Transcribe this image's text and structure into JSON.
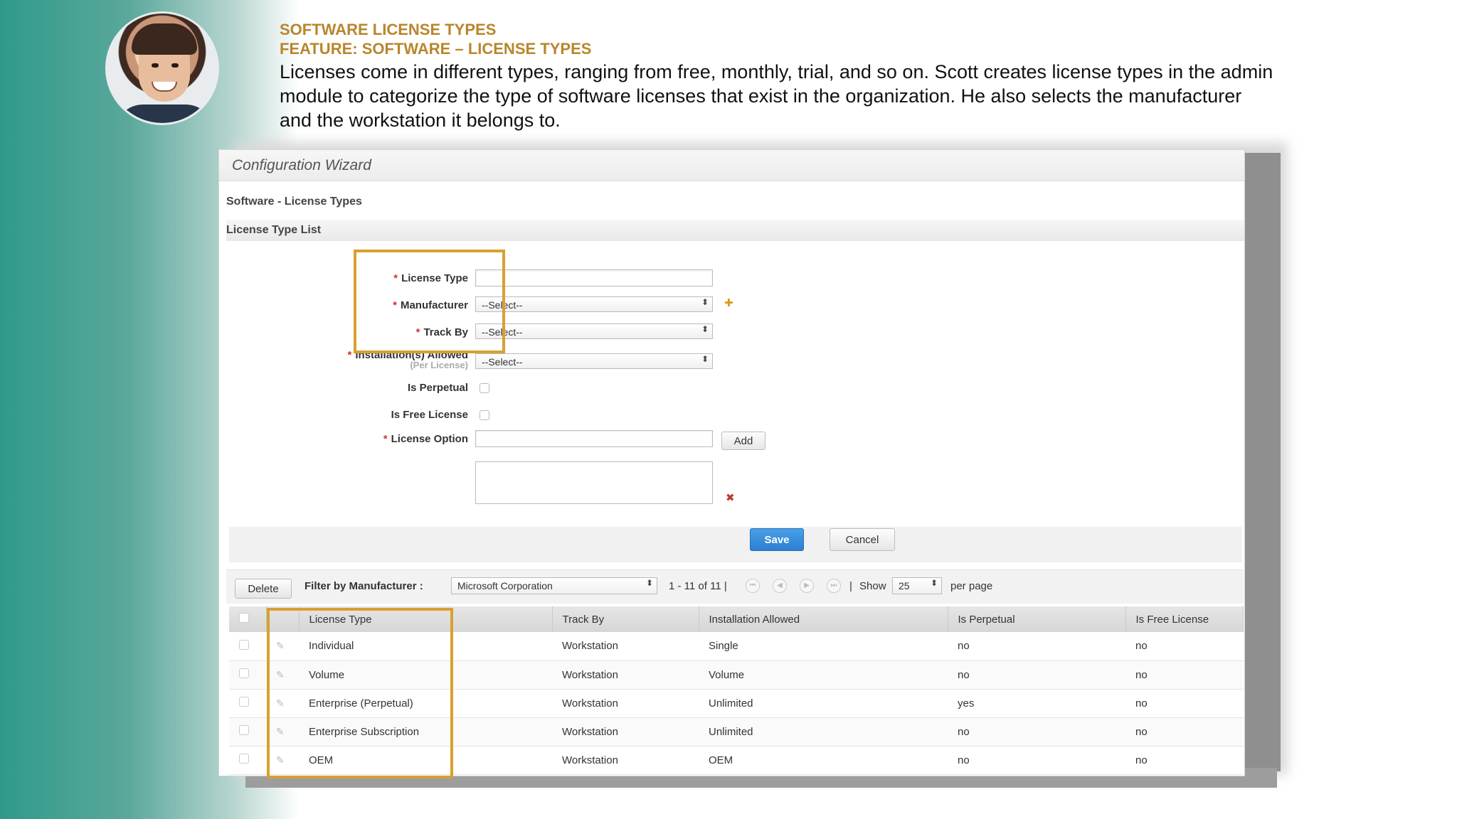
{
  "header": {
    "title": "SOFTWARE LICENSE TYPES",
    "feature": "FEATURE: SOFTWARE – LICENSE TYPES",
    "description": "Licenses come in different types, ranging from free, monthly, trial, and so on. Scott creates license types in the admin module to categorize the type of software licenses that exist in the organization. He also selects the manufacturer and the workstation it belongs to."
  },
  "wizard": {
    "title": "Configuration Wizard",
    "breadcrumb": "Software  -  License Types",
    "list_header": "License Type List"
  },
  "form": {
    "license_type_label": "License Type",
    "manufacturer_label": "Manufacturer",
    "manufacturer_value": "--Select--",
    "track_by_label": "Track By",
    "track_by_value": "--Select--",
    "installations_label": "Installation(s) Allowed",
    "installations_sublabel": "(Per License)",
    "installations_value": "--Select--",
    "is_perpetual_label": "Is Perpetual",
    "is_free_label": "Is Free License",
    "license_option_label": "License Option",
    "add_label": "Add",
    "save_label": "Save",
    "cancel_label": "Cancel"
  },
  "toolbar": {
    "delete_label": "Delete",
    "filter_label": "Filter by Manufacturer :",
    "filter_value": "Microsoft Corporation",
    "paging": "1 - 11 of 11 |",
    "separator": "|",
    "show_label": "Show",
    "show_value": "25",
    "per_page": "per page"
  },
  "table": {
    "columns": [
      "License Type",
      "Track By",
      "Installation Allowed",
      "Is Perpetual",
      "Is Free License"
    ],
    "rows": [
      [
        "Individual",
        "Workstation",
        "Single",
        "no",
        "no"
      ],
      [
        "Volume",
        "Workstation",
        "Volume",
        "no",
        "no"
      ],
      [
        "Enterprise (Perpetual)",
        "Workstation",
        "Unlimited",
        "yes",
        "no"
      ],
      [
        "Enterprise Subscription",
        "Workstation",
        "Unlimited",
        "no",
        "no"
      ],
      [
        "OEM",
        "Workstation",
        "OEM",
        "no",
        "no"
      ]
    ]
  },
  "colors": {
    "accent": "#b8862b",
    "highlight": "#d7a031",
    "save_button": "#2b7fcf"
  }
}
